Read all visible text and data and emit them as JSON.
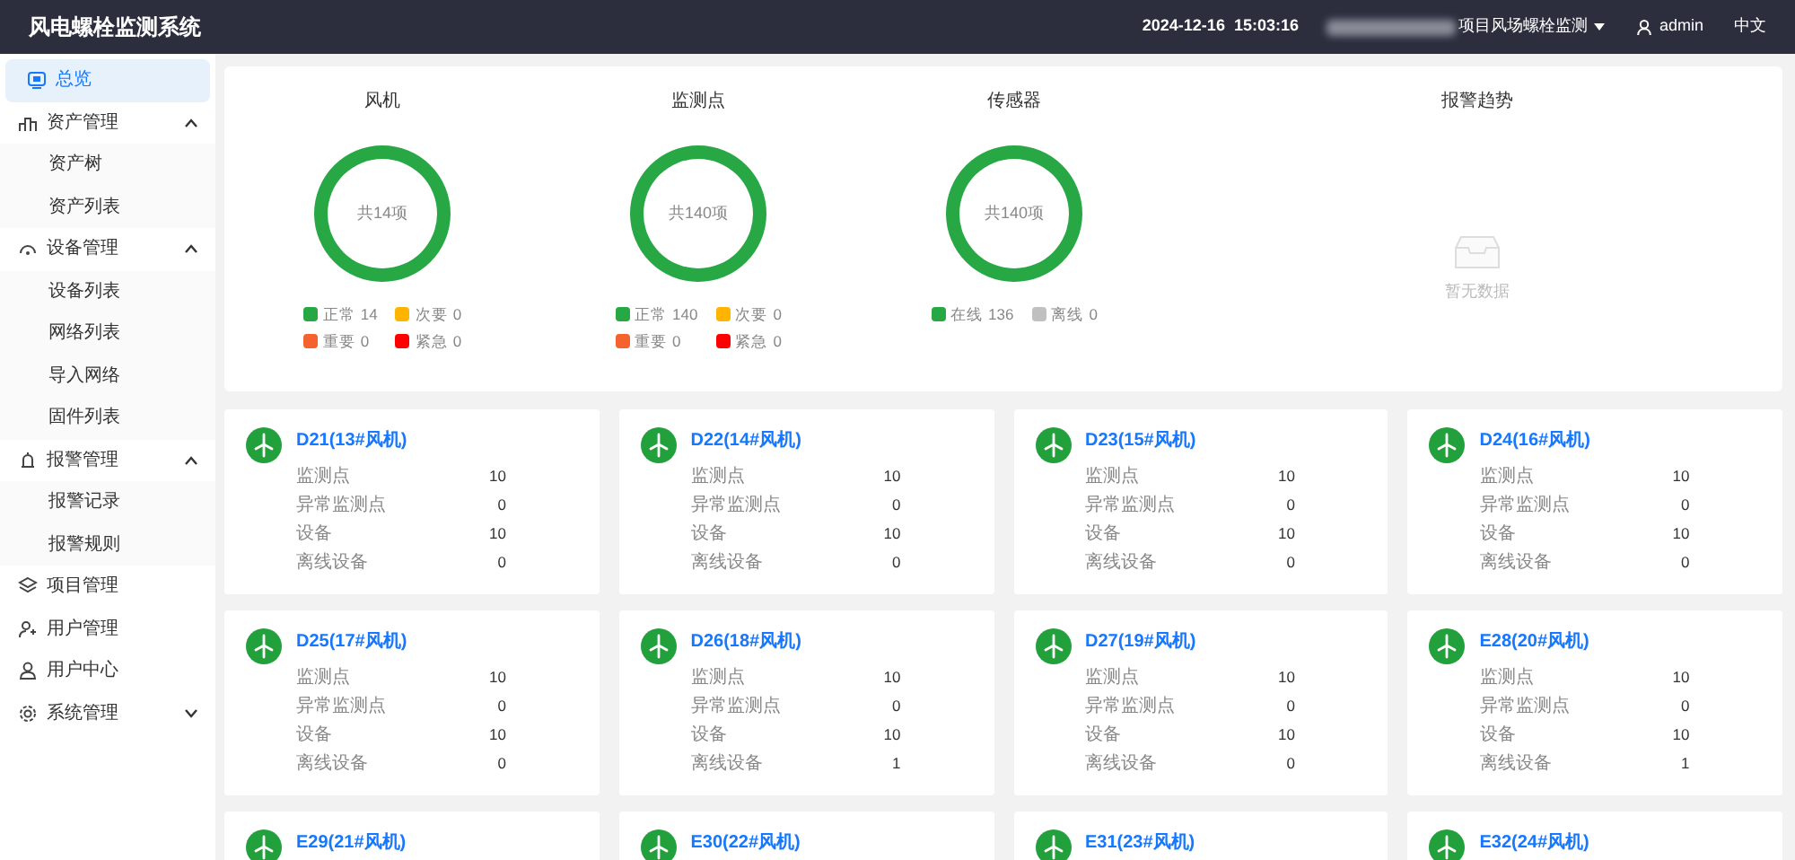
{
  "header": {
    "title": "风电螺栓监测系统",
    "datetime": "2024-12-16  15:03:16",
    "project": "项目风场螺栓监测",
    "user": "admin",
    "language": "中文"
  },
  "sidebar": {
    "items": [
      {
        "label": "总览",
        "selected": true
      },
      {
        "label": "资产管理",
        "selected": false,
        "expanded": true,
        "children": [
          {
            "label": "资产树",
            "selected": false
          },
          {
            "label": "资产列表",
            "selected": false
          }
        ]
      },
      {
        "label": "设备管理",
        "selected": false,
        "expanded": true,
        "children": [
          {
            "label": "设备列表",
            "selected": false
          },
          {
            "label": "网络列表",
            "selected": false
          },
          {
            "label": "导入网络",
            "selected": false
          },
          {
            "label": "固件列表",
            "selected": false
          }
        ]
      },
      {
        "label": "报警管理",
        "selected": false,
        "expanded": true,
        "children": [
          {
            "label": "报警记录",
            "selected": false
          },
          {
            "label": "报警规则",
            "selected": false
          }
        ]
      },
      {
        "label": "项目管理",
        "selected": false
      },
      {
        "label": "用户管理",
        "selected": false
      },
      {
        "label": "用户中心",
        "selected": false
      },
      {
        "label": "系统管理",
        "selected": false,
        "expanded": false
      }
    ]
  },
  "summary": {
    "donuts": [
      {
        "title": "风机",
        "center": "共14项",
        "legend": [
          {
            "label": "正常",
            "count": "14",
            "color": "#28a745"
          },
          {
            "label": "次要",
            "count": "0",
            "color": "#ffb400"
          },
          {
            "label": "重要",
            "count": "0",
            "color": "#f5622d"
          },
          {
            "label": "紧急",
            "count": "0",
            "color": "#ff0000"
          }
        ]
      },
      {
        "title": "监测点",
        "center": "共140项",
        "legend": [
          {
            "label": "正常",
            "count": "140",
            "color": "#28a745"
          },
          {
            "label": "次要",
            "count": "0",
            "color": "#ffb400"
          },
          {
            "label": "重要",
            "count": "0",
            "color": "#f5622d"
          },
          {
            "label": "紧急",
            "count": "0",
            "color": "#ff0000"
          }
        ]
      },
      {
        "title": "传感器",
        "center": "共140项",
        "legend": [
          {
            "label": "在线",
            "count": "136",
            "color": "#28a745"
          },
          {
            "label": "离线",
            "count": "0",
            "color": "#c0c0c0"
          }
        ]
      }
    ],
    "trend": {
      "title": "报警趋势",
      "empty_text": "暂无数据"
    }
  },
  "turbines": [
    {
      "name": "D21(13#风机)",
      "stats": [
        {
          "label": "监测点",
          "value": "10"
        },
        {
          "label": "异常监测点",
          "value": "0"
        },
        {
          "label": "设备",
          "value": "10"
        },
        {
          "label": "离线设备",
          "value": "0"
        }
      ]
    },
    {
      "name": "D22(14#风机)",
      "stats": [
        {
          "label": "监测点",
          "value": "10"
        },
        {
          "label": "异常监测点",
          "value": "0"
        },
        {
          "label": "设备",
          "value": "10"
        },
        {
          "label": "离线设备",
          "value": "0"
        }
      ]
    },
    {
      "name": "D23(15#风机)",
      "stats": [
        {
          "label": "监测点",
          "value": "10"
        },
        {
          "label": "异常监测点",
          "value": "0"
        },
        {
          "label": "设备",
          "value": "10"
        },
        {
          "label": "离线设备",
          "value": "0"
        }
      ]
    },
    {
      "name": "D24(16#风机)",
      "stats": [
        {
          "label": "监测点",
          "value": "10"
        },
        {
          "label": "异常监测点",
          "value": "0"
        },
        {
          "label": "设备",
          "value": "10"
        },
        {
          "label": "离线设备",
          "value": "0"
        }
      ]
    },
    {
      "name": "D25(17#风机)",
      "stats": [
        {
          "label": "监测点",
          "value": "10"
        },
        {
          "label": "异常监测点",
          "value": "0"
        },
        {
          "label": "设备",
          "value": "10"
        },
        {
          "label": "离线设备",
          "value": "0"
        }
      ]
    },
    {
      "name": "D26(18#风机)",
      "stats": [
        {
          "label": "监测点",
          "value": "10"
        },
        {
          "label": "异常监测点",
          "value": "0"
        },
        {
          "label": "设备",
          "value": "10"
        },
        {
          "label": "离线设备",
          "value": "1"
        }
      ]
    },
    {
      "name": "D27(19#风机)",
      "stats": [
        {
          "label": "监测点",
          "value": "10"
        },
        {
          "label": "异常监测点",
          "value": "0"
        },
        {
          "label": "设备",
          "value": "10"
        },
        {
          "label": "离线设备",
          "value": "0"
        }
      ]
    },
    {
      "name": "E28(20#风机)",
      "stats": [
        {
          "label": "监测点",
          "value": "10"
        },
        {
          "label": "异常监测点",
          "value": "0"
        },
        {
          "label": "设备",
          "value": "10"
        },
        {
          "label": "离线设备",
          "value": "1"
        }
      ]
    },
    {
      "name": "E29(21#风机)"
    },
    {
      "name": "E30(22#风机)"
    },
    {
      "name": "E31(23#风机)"
    },
    {
      "name": "E32(24#风机)"
    }
  ]
}
